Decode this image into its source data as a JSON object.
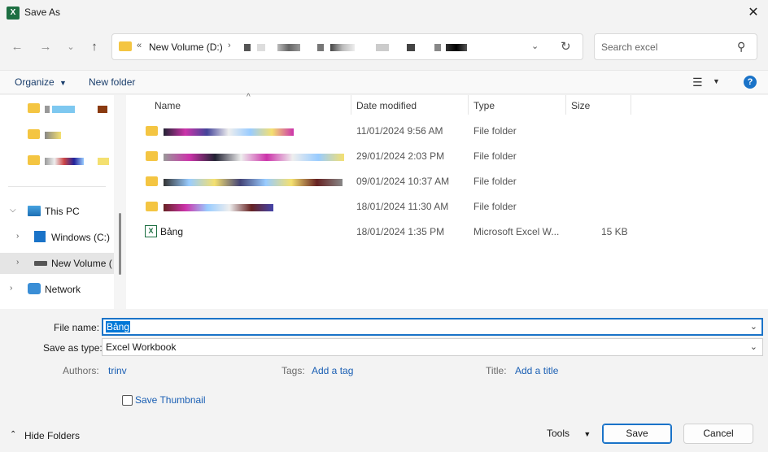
{
  "window": {
    "title": "Save As",
    "app_icon": "excel-icon"
  },
  "address": {
    "crumb_root": "New Volume (D:)",
    "refresh": "refresh-icon"
  },
  "search": {
    "placeholder": "Search excel"
  },
  "toolbar": {
    "organize_label": "Organize",
    "new_folder_label": "New folder"
  },
  "nav": {
    "this_pc": "This PC",
    "windows_c": "Windows (C:)",
    "new_volume": "New Volume (D:)",
    "network": "Network"
  },
  "columns": {
    "name": "Name",
    "date": "Date modified",
    "type": "Type",
    "size": "Size"
  },
  "files": [
    {
      "name": "",
      "date": "11/01/2024 9:56 AM",
      "type": "File folder",
      "size": ""
    },
    {
      "name": "",
      "date": "29/01/2024 2:03 PM",
      "type": "File folder",
      "size": ""
    },
    {
      "name": "",
      "date": "09/01/2024 10:37 AM",
      "type": "File folder",
      "size": ""
    },
    {
      "name": "",
      "date": "18/01/2024 11:30 AM",
      "type": "File folder",
      "size": ""
    },
    {
      "name": "Bảng",
      "date": "18/01/2024 1:35 PM",
      "type": "Microsoft Excel W...",
      "size": "15 KB"
    }
  ],
  "form": {
    "file_name_label": "File name:",
    "file_name_value": "Bảng",
    "save_type_label": "Save as type:",
    "save_type_value": "Excel Workbook",
    "authors_label": "Authors:",
    "authors_value": "trinv",
    "tags_label": "Tags:",
    "tags_value": "Add a tag",
    "title_label": "Title:",
    "title_value": "Add a title",
    "thumbnail_label": "Save Thumbnail"
  },
  "footer": {
    "hide_folders": "Hide Folders",
    "tools": "Tools",
    "save": "Save",
    "cancel": "Cancel"
  },
  "colors": {
    "accent": "#1a73c8",
    "folder": "#f4c542",
    "excel_green": "#1d6f42"
  }
}
